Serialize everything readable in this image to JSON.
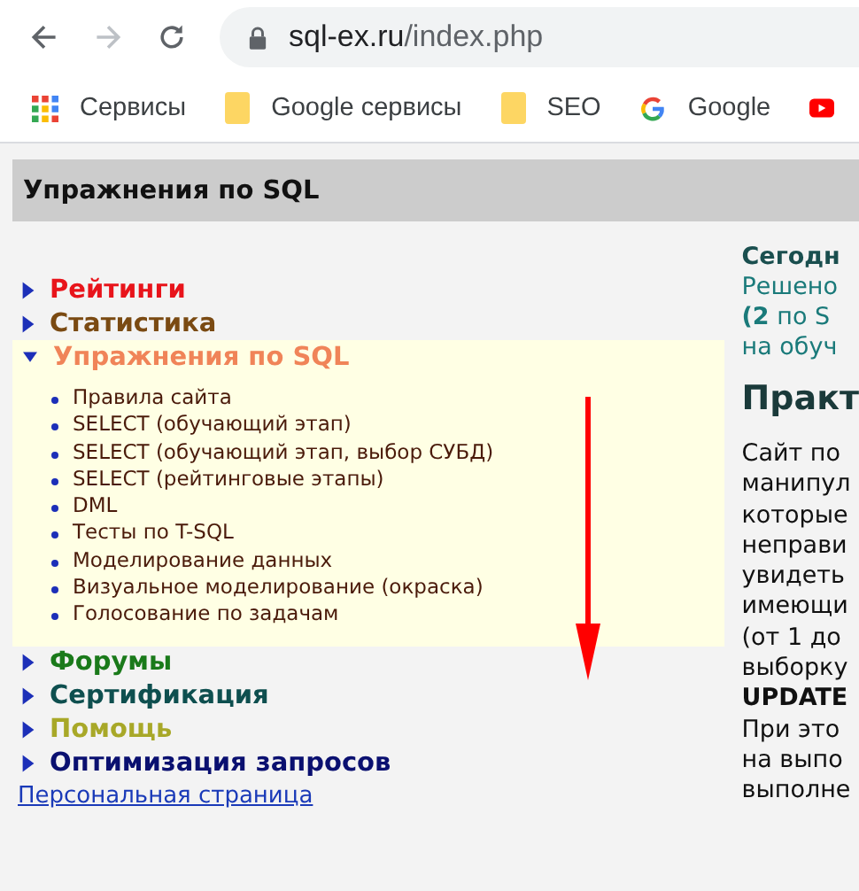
{
  "browser": {
    "nav": [
      {
        "kind": "back",
        "disabled": false
      },
      {
        "kind": "forward",
        "disabled": true
      },
      {
        "kind": "reload",
        "disabled": false
      }
    ],
    "url_host": "sql-ex.ru",
    "url_path": "/index.php",
    "bookmarks": [
      {
        "kind": "apps",
        "label": "Сервисы"
      },
      {
        "kind": "folder",
        "label": "Google сервисы"
      },
      {
        "kind": "folder",
        "label": "SEO"
      },
      {
        "kind": "google",
        "label": "Google"
      },
      {
        "kind": "youtube"
      }
    ]
  },
  "header_title": "Упражнения по SQL",
  "menu": [
    {
      "label": "Рейтинги",
      "color": "#e8141b",
      "expanded": false
    },
    {
      "label": "Статистика",
      "color": "#7a4a12",
      "expanded": false
    },
    {
      "label": "Упражнения по SQL",
      "color": "#f08458",
      "expanded": true,
      "children": [
        "Правила сайта",
        "SELECT (обучающий этап)",
        "SELECT (обучающий этап, выбор СУБД)",
        "SELECT (рейтинговые этапы)",
        "DML",
        "Тесты по T-SQL",
        "Моделирование данных",
        "Визуальное моделирование (окраска)",
        "Голосование по задачам"
      ]
    },
    {
      "label": "Форумы",
      "color": "#1a7a1a",
      "expanded": false
    },
    {
      "label": "Сертификация",
      "color": "#0e4f4f",
      "expanded": false
    },
    {
      "label": "Помощь",
      "color": "#a8a828",
      "expanded": false
    },
    {
      "label": "Оптимизация запросов",
      "color": "#0a1070",
      "expanded": false
    }
  ],
  "personal_link": "Персональная страница",
  "news": {
    "title": "Сегодн",
    "lines": [
      "Решено",
      "**(2** по S",
      "на обуч"
    ]
  },
  "article": {
    "heading": "Практ",
    "lines": [
      "Сайт по",
      "манипул",
      "которые",
      "неправи",
      "увидеть",
      "имеющи",
      "(от 1 до",
      "выборку",
      "**UPDATE**",
      "При это",
      "на выпо",
      "выполне"
    ]
  }
}
